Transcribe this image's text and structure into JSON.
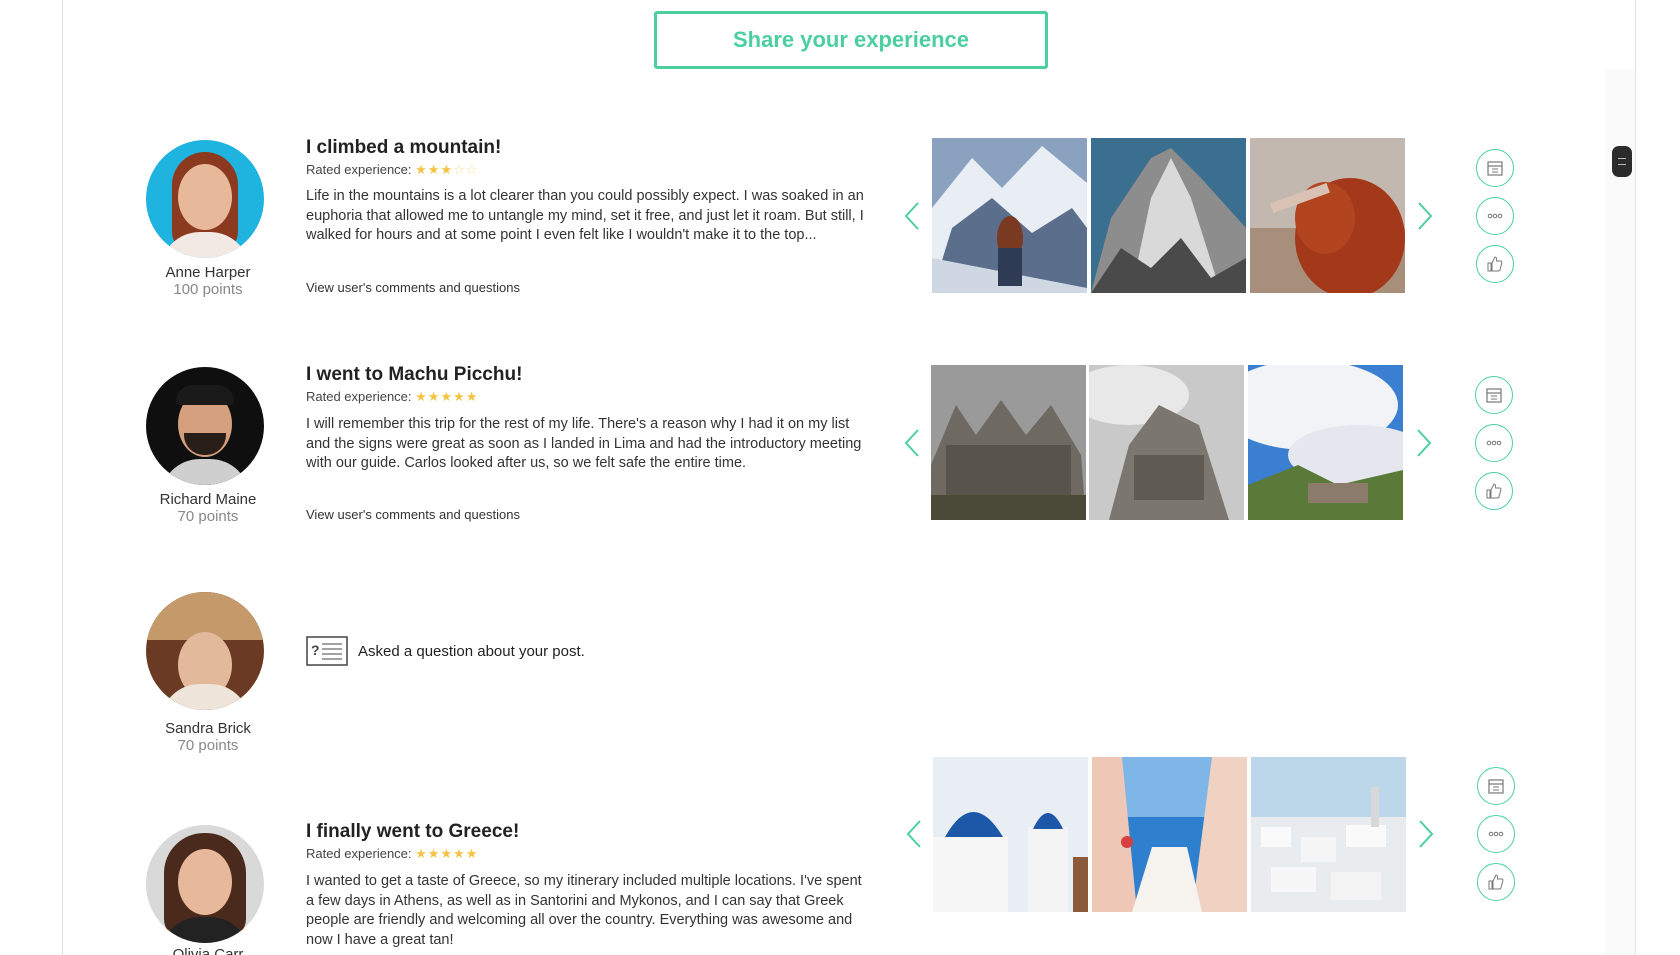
{
  "header": {
    "share_label": "Share your experience"
  },
  "rated_label": "Rated experience:",
  "view_link_label": "View user's comments and questions",
  "posts": [
    {
      "user": {
        "name": "Anne Harper",
        "points": "100 points"
      },
      "title": "I climbed a mountain!",
      "rating": 3,
      "rating_max": 5,
      "text": "Life in the mountains is a lot clearer than you could possibly expect. I was soaked in an euphoria that allowed me to untangle my mind, set it free, and just let it roam. But still, I walked for hours and at some point I even felt like I wouldn't make it to the top...",
      "photos": [
        "snowy-mountain-woman",
        "rocky-peak",
        "red-hair-woman"
      ]
    },
    {
      "user": {
        "name": "Richard Maine",
        "points": "70 points"
      },
      "title": "I went to Machu Picchu!",
      "rating": 5,
      "rating_max": 5,
      "text": "I will remember this trip for the rest of my life. There's a reason why I had it on my list and the signs were great as soon as I landed in Lima and had the introductory meeting with our guide. Carlos looked after us, so we felt safe the entire time.",
      "photos": [
        "stone-ruins",
        "misty-ruins",
        "machu-picchu-valley"
      ]
    },
    {
      "user": {
        "name": "Sandra Brick",
        "points": "70 points"
      },
      "question_text": "Asked a question about your post."
    },
    {
      "user": {
        "name": "Olivia Carr"
      },
      "title": "I finally went to Greece!",
      "rating": 5,
      "rating_max": 5,
      "text": "I wanted to get a taste of Greece, so my itinerary included multiple locations. I've spent a few days in Athens, as well as in Santorini and Mykonos, and I can say that Greek people are friendly and welcoming all over the country. Everything was awesome and now I have a great tan!",
      "photos": [
        "blue-domes",
        "sea-stairs",
        "white-village"
      ]
    }
  ],
  "colors": {
    "accent": "#4ccf9f",
    "star": "#f4c343"
  }
}
